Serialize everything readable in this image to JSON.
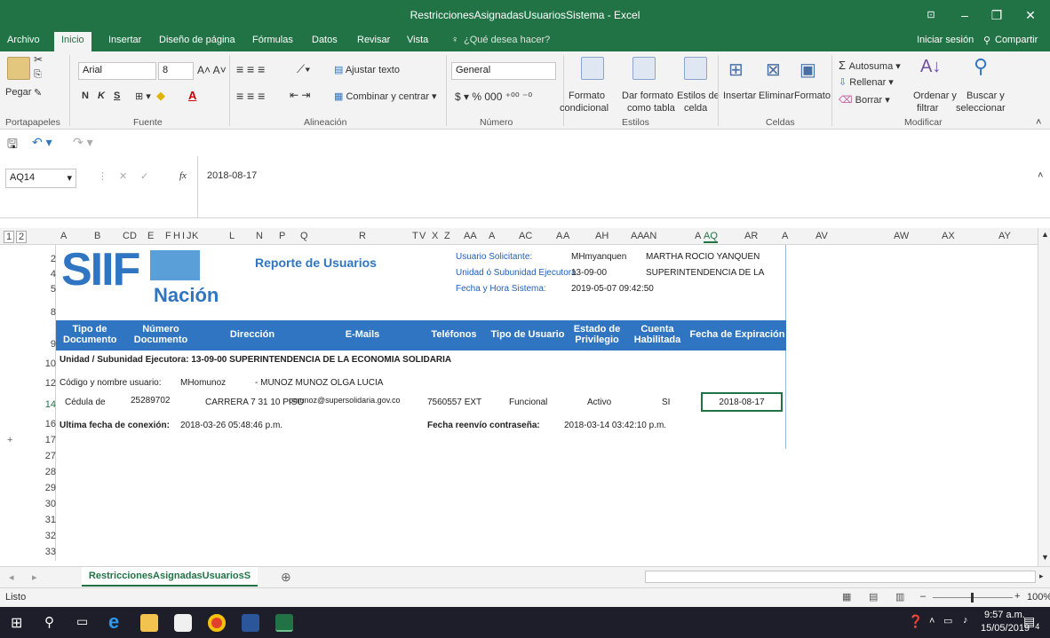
{
  "window": {
    "title": "RestriccionesAsignadasUsuariosSistema - Excel"
  },
  "tabs": [
    "Archivo",
    "Inicio",
    "Insertar",
    "Diseño de página",
    "Fórmulas",
    "Datos",
    "Revisar",
    "Vista"
  ],
  "tell_me": "¿Qué desea hacer?",
  "signin": "Iniciar sesión",
  "share": "Compartir",
  "ribbon": {
    "paste": "Pegar",
    "font_name": "Arial",
    "font_size": "8",
    "bold": "N",
    "italic": "K",
    "underline": "S",
    "wrap_text": "Ajustar texto",
    "merge_center": "Combinar y centrar",
    "number_format": "General",
    "cond_format_1": "Formato",
    "cond_format_2": "condicional",
    "format_table_1": "Dar formato",
    "format_table_2": "como tabla",
    "cell_styles_1": "Estilos de",
    "cell_styles_2": "celda",
    "insert": "Insertar",
    "delete": "Eliminar",
    "format": "Formato",
    "autosum": "Autosuma",
    "fill": "Rellenar",
    "clear": "Borrar",
    "sort_1": "Ordenar y",
    "sort_2": "filtrar",
    "find_1": "Buscar y",
    "find_2": "seleccionar",
    "groups": {
      "clipboard": "Portapapeles",
      "font": "Fuente",
      "alignment": "Alineación",
      "number": "Número",
      "styles": "Estilos",
      "cells": "Celdas",
      "edit": "Modificar"
    }
  },
  "formula_bar": {
    "name_box": "AQ14",
    "value": "2018-08-17",
    "fx": "fx"
  },
  "columns": [
    "A",
    "B",
    "C",
    "D",
    "E",
    "F",
    "H",
    "I",
    "J",
    "K",
    "L",
    "N",
    "P",
    "Q",
    "R",
    "T",
    "V",
    "X",
    "Z",
    "AA",
    "A",
    "AC",
    "A",
    "A",
    "AH",
    "AA",
    "AN",
    "A",
    "AQ",
    "AR",
    "A",
    "AV",
    "AW",
    "AX",
    "AY"
  ],
  "rows": [
    "2",
    "4",
    "5",
    "8",
    "9",
    "10",
    "12",
    "14",
    "16",
    "17",
    "27",
    "28",
    "29",
    "30",
    "31",
    "32",
    "33"
  ],
  "report": {
    "logo_text": "SIIF",
    "logo_sub": "Nación",
    "title": "Reporte de Usuarios",
    "req_user_label": "Usuario Solicitante:",
    "req_user_value": "MHmyanquen",
    "req_user_name": "MARTHA ROCIO YANQUEN",
    "unit_label": "Unidad ó Subunidad Ejecutora",
    "unit_value": "13-09-00",
    "unit_name": "SUPERINTENDENCIA DE LA",
    "date_label": "Fecha y Hora Sistema:",
    "date_value": "2019-05-07 09:42:50",
    "headers": {
      "doc_type": "Tipo de Documento",
      "doc_num": "Número Documento",
      "address": "Dirección",
      "emails": "E-Mails",
      "phones": "Teléfonos",
      "user_type": "Tipo de Usuario",
      "priv_state": "Estado de Privilegio",
      "account": "Cuenta Habilitada",
      "expiry": "Fecha de Expiración"
    },
    "unit_line": "Unidad / Subunidad Ejecutora:  13-09-00 SUPERINTENDENCIA DE LA ECONOMIA SOLIDARIA",
    "code_label": "Código y nombre usuario:",
    "code_value": "MHomunoz",
    "code_name": "- MUNOZ MUNOZ OLGA LUCIA",
    "row": {
      "doc_type": "Cédula de",
      "doc_num": "25289702",
      "address": "CARRERA 7 31 10 PISO",
      "email": "omunoz@supersolidaria.gov.co",
      "phone": "7560557 EXT",
      "user_type": "Funcional",
      "priv": "Activo",
      "account": "SI",
      "expiry": "2018-08-17"
    },
    "last_conn_label": "Ultima fecha de conexión:",
    "last_conn_value": "2018-03-26 05:48:46 p.m.",
    "pwd_label": "Fecha reenvío contraseña:",
    "pwd_value": "2018-03-14 03:42:10 p.m."
  },
  "sheet_tab": "RestriccionesAsignadasUsuariosS",
  "status": {
    "ready": "Listo",
    "zoom": "100%"
  },
  "taskbar": {
    "time": "9:57 a.m.",
    "date": "15/05/2019",
    "notif": "4"
  },
  "colors": {
    "excel_green": "#217346",
    "banner_blue": "#2f75c2",
    "link_blue": "#1f5fbf"
  }
}
